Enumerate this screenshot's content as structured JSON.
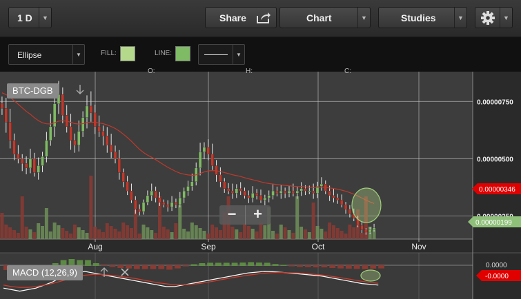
{
  "toolbar": {
    "period": "1 D",
    "share": "Share",
    "chart": "Chart",
    "studies": "Studies"
  },
  "drawing": {
    "shape": "Ellipse",
    "fill_label": "FILL:",
    "line_label": "LINE:",
    "fill_color": "#b4d98a",
    "line_color": "#7fba64"
  },
  "chart": {
    "symbol": "BTC-DGB",
    "y_ticks": [
      "0.00000750",
      "0.00000500",
      "0.00000250"
    ],
    "x_ticks": [
      "Aug",
      "Sep",
      "Oct",
      "Nov"
    ],
    "header_letters": [
      "O:",
      "H:",
      "C:"
    ],
    "price_red_badge": "0.00000346",
    "price_green_badge": "0.00000199",
    "colors": {
      "up": "#7fba64",
      "down": "#c0392b",
      "ma": "#c0392b",
      "bg": "#3d3d3d"
    }
  },
  "macd": {
    "label": "MACD (12,26,9)",
    "y_tick": "0.0000",
    "badge": "-0.0000"
  },
  "chart_data": {
    "type": "line",
    "title": "BTC-DGB",
    "x_ticks": [
      "Aug",
      "Sep",
      "Oct",
      "Nov"
    ],
    "y_ticks": [
      2.5e-06,
      5e-06,
      7.5e-06
    ],
    "ylim": [
      1.5e-06,
      8.8e-06
    ],
    "last_ma": 3.46e-06,
    "last_close": 1.99e-06,
    "close": [
      7.2e-06,
      6.6e-06,
      5.8e-06,
      5.2e-06,
      5e-06,
      4.8e-06,
      4.6e-06,
      5e-06,
      4.4e-06,
      4.7e-06,
      5.1e-06,
      5.8e-06,
      6.4e-06,
      7.4e-06,
      7.8e-06,
      6.9e-06,
      6.4e-06,
      5.8e-06,
      5.6e-06,
      6.2e-06,
      6.8e-06,
      7.3e-06,
      7e-06,
      6.4e-06,
      6.2e-06,
      6e-06,
      5.6e-06,
      5.3e-06,
      5e-06,
      4.4e-06,
      4e-06,
      3.6e-06,
      3.2e-06,
      2.8e-06,
      2.7e-06,
      3.1e-06,
      3.4e-06,
      3.6e-06,
      3.3e-06,
      3.1e-06,
      3e-06,
      2.9e-06,
      3.1e-06,
      3e-06,
      3.3e-06,
      3.6e-06,
      3.8e-06,
      4e-06,
      4.6e-06,
      5.3e-06,
      5.5e-06,
      5.2e-06,
      4.7e-06,
      4.3e-06,
      4e-06,
      3.7e-06,
      3.6e-06,
      3.5e-06,
      3.7e-06,
      3.6e-06,
      3.4e-06,
      3.3e-06,
      3.5e-06,
      3.4e-06,
      3.2e-06,
      3.3e-06,
      3.4e-06,
      3.6e-06,
      3.5e-06,
      3.6e-06,
      3.5e-06,
      3.6e-06,
      3.5e-06,
      3.6e-06,
      3.7e-06,
      3.6e-06,
      3.6e-06,
      3.5e-06,
      3.8e-06,
      3.9e-06,
      3.6e-06,
      3.4e-06,
      3.3e-06,
      3.2e-06,
      3e-06,
      2.8e-06,
      2.6e-06,
      2.4e-06,
      2.1e-06,
      1.9e-06,
      1.8e-06,
      1.9e-06,
      1.99e-06
    ],
    "macd_line": [
      -0.6,
      -0.7,
      -0.8,
      -0.7,
      -0.6,
      -0.4,
      -0.2,
      0.1,
      0.3,
      0.4,
      0.5,
      0.4,
      0.3,
      0.2,
      0.1,
      0.0,
      -0.1,
      -0.2,
      -0.3,
      -0.4,
      -0.5,
      -0.5,
      -0.4,
      -0.3,
      -0.2,
      -0.1,
      0.0,
      0.1,
      0.2,
      0.3,
      0.4,
      0.45,
      0.5,
      0.48,
      0.45,
      0.4,
      0.35,
      0.3,
      0.25,
      0.2,
      0.1,
      0.0,
      -0.1,
      -0.2,
      -0.3,
      -0.35,
      -0.4
    ],
    "signal_line": [
      -0.4,
      -0.5,
      -0.55,
      -0.55,
      -0.5,
      -0.4,
      -0.3,
      -0.15,
      0.0,
      0.15,
      0.25,
      0.3,
      0.3,
      0.25,
      0.2,
      0.12,
      0.05,
      -0.05,
      -0.15,
      -0.25,
      -0.32,
      -0.38,
      -0.38,
      -0.35,
      -0.3,
      -0.22,
      -0.12,
      -0.02,
      0.08,
      0.17,
      0.25,
      0.32,
      0.38,
      0.42,
      0.43,
      0.42,
      0.4,
      0.36,
      0.32,
      0.27,
      0.2,
      0.12,
      0.03,
      -0.06,
      -0.15,
      -0.22,
      -0.28
    ]
  }
}
